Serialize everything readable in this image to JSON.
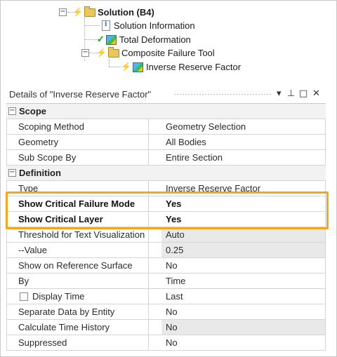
{
  "tree": {
    "solution_label": "Solution (B4)",
    "children": [
      {
        "label": "Solution Information",
        "icon": "solution-information-icon"
      },
      {
        "label": "Total Deformation",
        "icon": "total-deformation-icon"
      },
      {
        "label": "Composite Failure Tool",
        "icon": "folder-icon"
      },
      {
        "label": "Inverse Reserve Factor",
        "icon": "result-cube-icon"
      }
    ]
  },
  "details": {
    "title": "Details of \"Inverse Reserve Factor\"",
    "controls": {
      "dropdown": "▾",
      "pin": "⊥",
      "maximize": "□",
      "close": "✕"
    },
    "categories": {
      "scope": "Scope",
      "definition": "Definition"
    },
    "rows": [
      {
        "key": "Scoping Method",
        "value": "Geometry Selection"
      },
      {
        "key": "Geometry",
        "value": "All Bodies"
      },
      {
        "key": "Sub Scope By",
        "value": "Entire Section"
      },
      {
        "key": "Type",
        "value": "Inverse Reserve Factor"
      },
      {
        "key": "Show Critical Failure Mode",
        "value": "Yes"
      },
      {
        "key": "Show Critical Layer",
        "value": "Yes"
      },
      {
        "key": "Threshold for Text Visualization",
        "value": "Auto"
      },
      {
        "key": "--Value",
        "value": "0.25"
      },
      {
        "key": "Show on Reference Surface",
        "value": "No"
      },
      {
        "key": "By",
        "value": "Time"
      },
      {
        "key": "Display Time",
        "value": "Last"
      },
      {
        "key": "Separate Data by Entity",
        "value": "No"
      },
      {
        "key": "Calculate Time History",
        "value": "No"
      },
      {
        "key": "Suppressed",
        "value": "No"
      }
    ]
  },
  "colors": {
    "highlight": "#f3a71f",
    "shaded_value": "#e9e9e9",
    "category_bg": "#f2f2f2"
  }
}
